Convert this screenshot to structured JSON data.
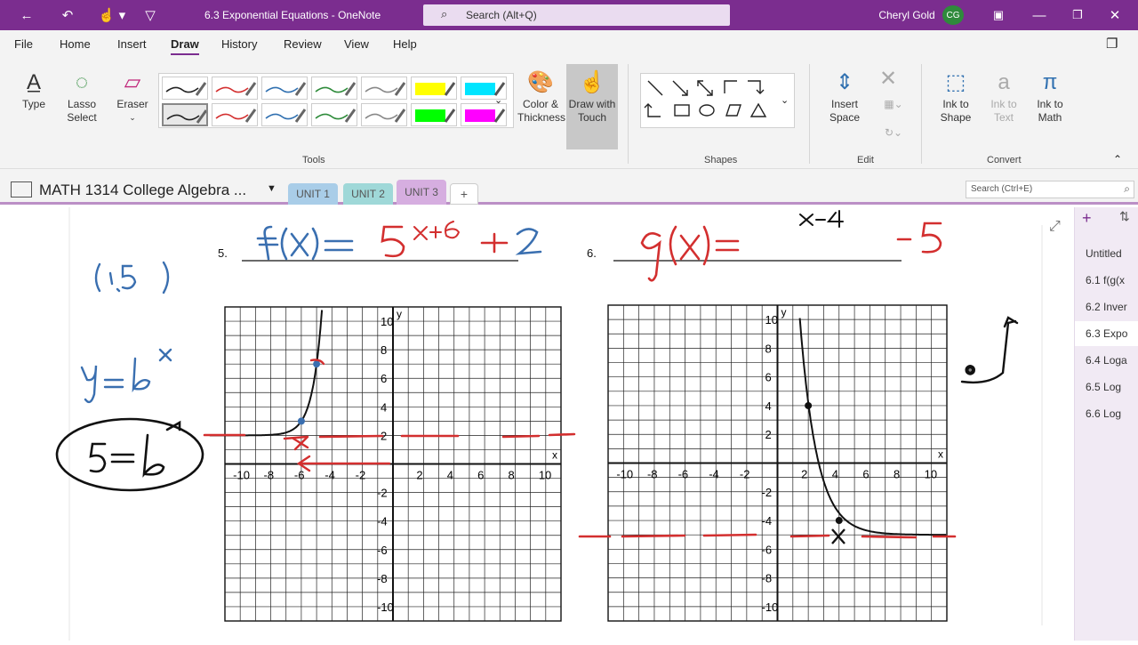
{
  "window": {
    "title": "6.3 Exponential Equations - OneNote",
    "search_placeholder": "Search (Alt+Q)",
    "user_name": "Cheryl Gold",
    "user_initials": "CG",
    "accent_color": "#7b2d8f"
  },
  "menu": [
    "File",
    "Home",
    "Insert",
    "Draw",
    "History",
    "Review",
    "View",
    "Help"
  ],
  "active_menu": "Draw",
  "ribbon": {
    "type_label": "Type",
    "lasso_label": "Lasso Select",
    "eraser_label": "Eraser",
    "color_label": "Color & Thickness",
    "draw_touch_label": "Draw with Touch",
    "tools_group": "Tools",
    "shapes_group": "Shapes",
    "insert_space_label": "Insert Space",
    "edit_group": "Edit",
    "ink_shape_label": "Ink to Shape",
    "ink_text_label": "Ink to Text",
    "ink_math_label": "Ink to Math",
    "convert_group": "Convert",
    "pen_colors": [
      "#222222",
      "#d32f2f",
      "#3070b0",
      "#2e8b3a",
      "#888888",
      "#ffff00",
      "#00e5ff",
      "#222222",
      "#d32f2f",
      "#3070b0",
      "#2e8b3a",
      "#888888",
      "#00ff00",
      "#ff00ff"
    ]
  },
  "notebook": {
    "title": "MATH 1314 College Algebra ...",
    "tabs": [
      "UNIT 1",
      "UNIT 2",
      "UNIT 3"
    ],
    "active_tab": "UNIT 3",
    "page_search": "Search (Ctrl+E)"
  },
  "pages": [
    "Untitled",
    "6.1  f(g(x",
    "6.2 Inver",
    "6.3 Expo",
    "6.4 Loga",
    "6.5 Log",
    "6.6  Log"
  ],
  "active_page": "6.3 Expo",
  "content": {
    "problem5_number": "5.",
    "problem6_number": "6.",
    "problem5_ink": "f(x) = 5^(x+6) + 2",
    "problem6_ink": "g(x) = ... x-4 ... -5",
    "note_point": "(1,5)",
    "note_eq": "y = b^x",
    "note_circled": "5 = b^1",
    "axis_labels": {
      "x": "x",
      "y": "y"
    },
    "x_ticks": [
      "-10",
      "-8",
      "-6",
      "-4",
      "-2",
      "2",
      "4",
      "6",
      "8",
      "10"
    ],
    "y_ticks": [
      "10",
      "8",
      "6",
      "4",
      "2",
      "-2",
      "-4",
      "-6",
      "-8",
      "-10"
    ]
  }
}
